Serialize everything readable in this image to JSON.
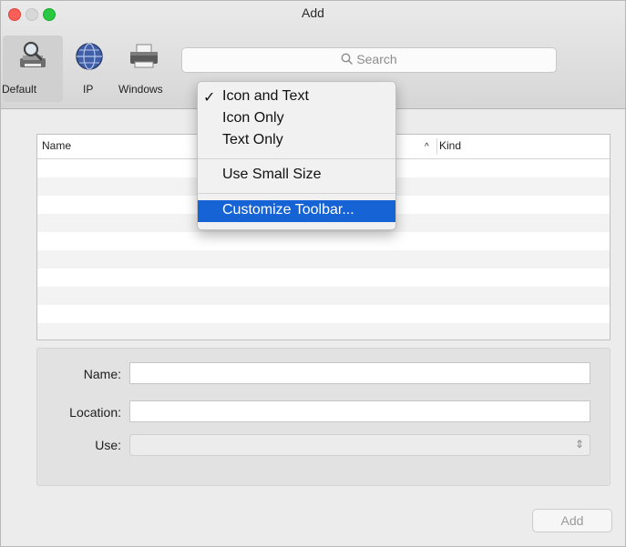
{
  "window": {
    "title": "Add"
  },
  "toolbar": {
    "items": [
      {
        "label": "Default",
        "icon": "magnifier-printer-icon",
        "selected": true
      },
      {
        "label": "IP",
        "icon": "globe-icon",
        "selected": false
      },
      {
        "label": "Windows",
        "icon": "printer-icon",
        "selected": false
      }
    ],
    "search": {
      "placeholder": "Search",
      "icon": "search-icon"
    }
  },
  "context_menu": {
    "items": [
      {
        "label": "Icon and Text",
        "checked": true,
        "check_glyph": "✓"
      },
      {
        "label": "Icon Only",
        "checked": false
      },
      {
        "label": "Text Only",
        "checked": false
      },
      {
        "label": "Use Small Size",
        "checked": false
      },
      {
        "label": "Customize Toolbar...",
        "highlighted": true
      }
    ]
  },
  "table": {
    "columns": [
      {
        "label": "Name"
      },
      {
        "label": "Kind",
        "sort_glyph": "^"
      }
    ],
    "rows": []
  },
  "form": {
    "name_label": "Name:",
    "name_value": "",
    "location_label": "Location:",
    "location_value": "",
    "use_label": "Use:",
    "use_value": ""
  },
  "actions": {
    "add_label": "Add",
    "add_enabled": false
  },
  "colors": {
    "menu_highlight": "#1663d6",
    "close": "#fc5f57",
    "zoom": "#28c840"
  }
}
